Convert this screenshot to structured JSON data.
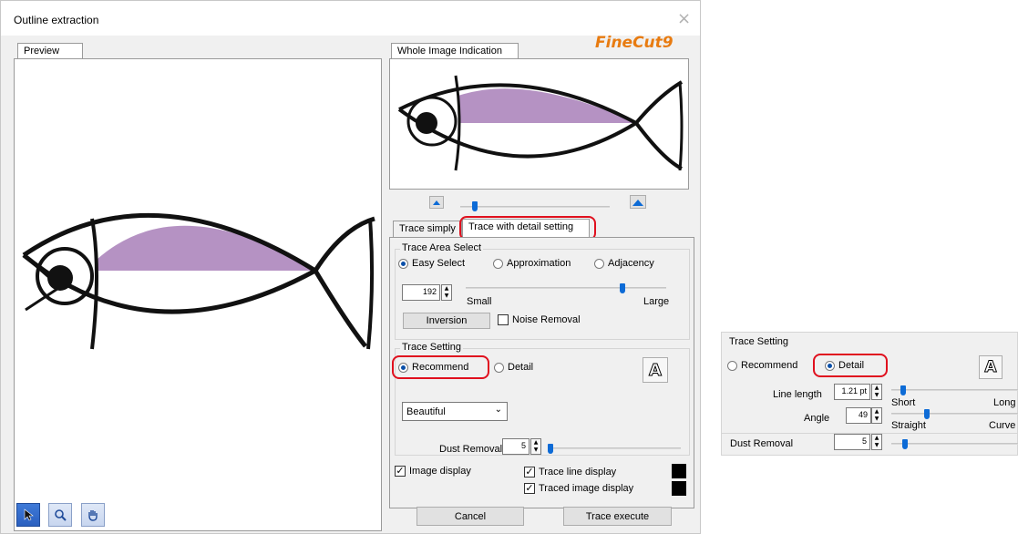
{
  "window": {
    "title": "Outline extraction",
    "close_glyph": "×"
  },
  "brand": {
    "logo_text": "FineCut9"
  },
  "preview": {
    "tab_label": "Preview"
  },
  "whole_image": {
    "tab_label": "Whole Image Indication",
    "zoom_level": 0.1
  },
  "trace_tabs": [
    {
      "label": "Trace simply",
      "selected": false
    },
    {
      "label": "Trace with detail setting",
      "selected": true
    }
  ],
  "trace_area": {
    "group_label": "Trace Area Select",
    "options": [
      {
        "label": "Easy Select",
        "checked": true
      },
      {
        "label": "Approximation",
        "checked": false
      },
      {
        "label": "Adjacency",
        "checked": false
      }
    ],
    "value": "192",
    "slider_small": "Small",
    "slider_large": "Large",
    "slider_level": 0.78,
    "inversion_button": "Inversion",
    "noise_removal": {
      "label": "Noise Removal",
      "checked": false
    }
  },
  "trace_setting": {
    "group_label": "Trace Setting",
    "options": [
      {
        "label": "Recommend",
        "checked": true
      },
      {
        "label": "Detail",
        "checked": false
      }
    ],
    "style_select": "Beautiful",
    "dust_removal_label": "Dust Removal",
    "dust_removal_value": "5",
    "dust_level": 0.02
  },
  "display": {
    "image_display": {
      "label": "Image display",
      "checked": true
    },
    "trace_line_display": {
      "label": "Trace line display",
      "checked": true
    },
    "traced_image_display": {
      "label": "Traced image display",
      "checked": true
    },
    "swatch_color": "#000000"
  },
  "tools": [
    "pointer-icon",
    "zoom-icon",
    "hand-icon"
  ],
  "buttons": {
    "cancel": "Cancel",
    "execute": "Trace execute"
  },
  "detail_panel": {
    "group_label": "Trace Setting",
    "options": [
      {
        "label": "Recommend",
        "checked": false
      },
      {
        "label": "Detail",
        "checked": true
      }
    ],
    "line_length_label": "Line length",
    "line_length_value": "1.21 pt",
    "line_short": "Short",
    "line_long": "Long",
    "angle_label": "Angle",
    "angle_value": "49",
    "angle_straight": "Straight",
    "angle_curve": "Curve",
    "dust_removal_label": "Dust Removal",
    "dust_removal_value": "5"
  },
  "colors": {
    "accent": "#0d6bd6",
    "highlight": "#e0101e",
    "fish_fill": "#b592c3",
    "brand_orange": "#e87b10"
  }
}
